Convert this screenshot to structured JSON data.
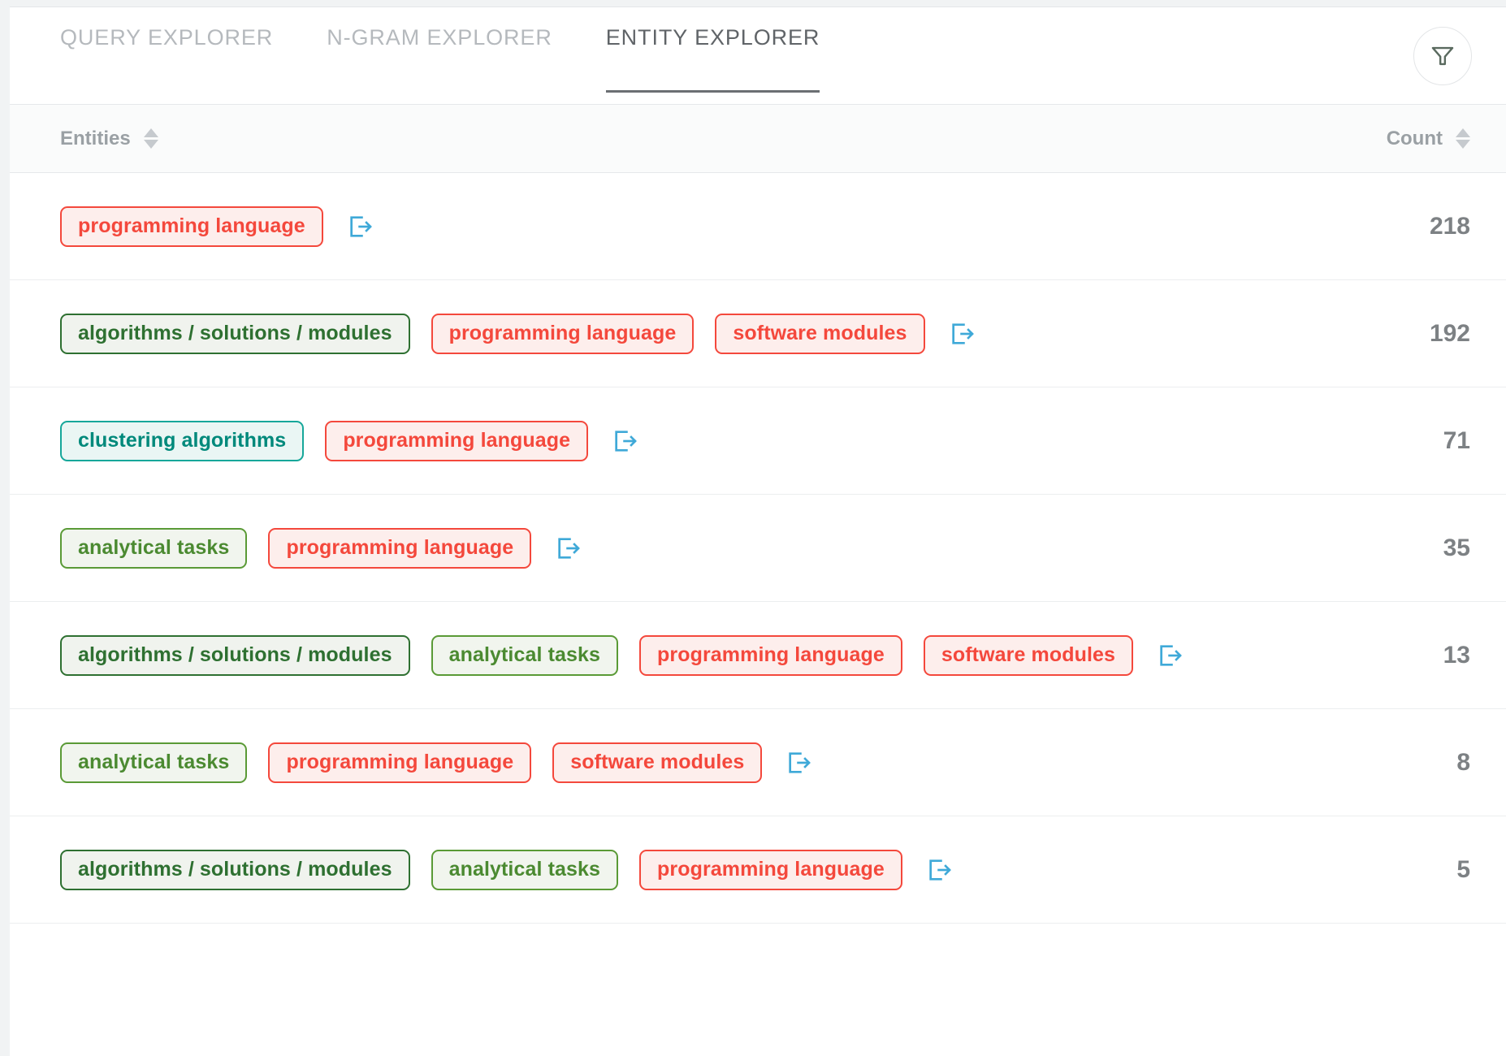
{
  "tabs": [
    {
      "label": "QUERY EXPLORER",
      "active": false
    },
    {
      "label": "N-GRAM EXPLORER",
      "active": false
    },
    {
      "label": "ENTITY EXPLORER",
      "active": true
    }
  ],
  "toolbar": {
    "filter_icon": "filter-funnel-icon"
  },
  "table": {
    "headers": {
      "entities": "Entities",
      "count": "Count"
    },
    "row_action_icon": "open-external-icon",
    "rows": [
      {
        "tags": [
          {
            "label": "programming language",
            "color": "red"
          }
        ],
        "count": "218"
      },
      {
        "tags": [
          {
            "label": "algorithms / solutions / modules",
            "color": "green"
          },
          {
            "label": "programming language",
            "color": "red"
          },
          {
            "label": "software modules",
            "color": "red"
          }
        ],
        "count": "192"
      },
      {
        "tags": [
          {
            "label": "clustering algorithms",
            "color": "teal"
          },
          {
            "label": "programming language",
            "color": "red"
          }
        ],
        "count": "71"
      },
      {
        "tags": [
          {
            "label": "analytical tasks",
            "color": "lgreen"
          },
          {
            "label": "programming language",
            "color": "red"
          }
        ],
        "count": "35"
      },
      {
        "tags": [
          {
            "label": "algorithms / solutions / modules",
            "color": "green"
          },
          {
            "label": "analytical tasks",
            "color": "lgreen"
          },
          {
            "label": "programming language",
            "color": "red"
          },
          {
            "label": "software modules",
            "color": "red"
          }
        ],
        "count": "13"
      },
      {
        "tags": [
          {
            "label": "analytical tasks",
            "color": "lgreen"
          },
          {
            "label": "programming language",
            "color": "red"
          },
          {
            "label": "software modules",
            "color": "red"
          }
        ],
        "count": "8"
      },
      {
        "tags": [
          {
            "label": "algorithms / solutions / modules",
            "color": "green"
          },
          {
            "label": "analytical tasks",
            "color": "lgreen"
          },
          {
            "label": "programming language",
            "color": "red"
          }
        ],
        "count": "5"
      }
    ]
  },
  "colors": {
    "red": "#f4483c",
    "green": "#2e7031",
    "light_green": "#5a9a36",
    "teal": "#00897b",
    "icon_blue": "#3fa9d8",
    "active_tab": "#606468",
    "inactive_tab": "#b5b9bd"
  }
}
